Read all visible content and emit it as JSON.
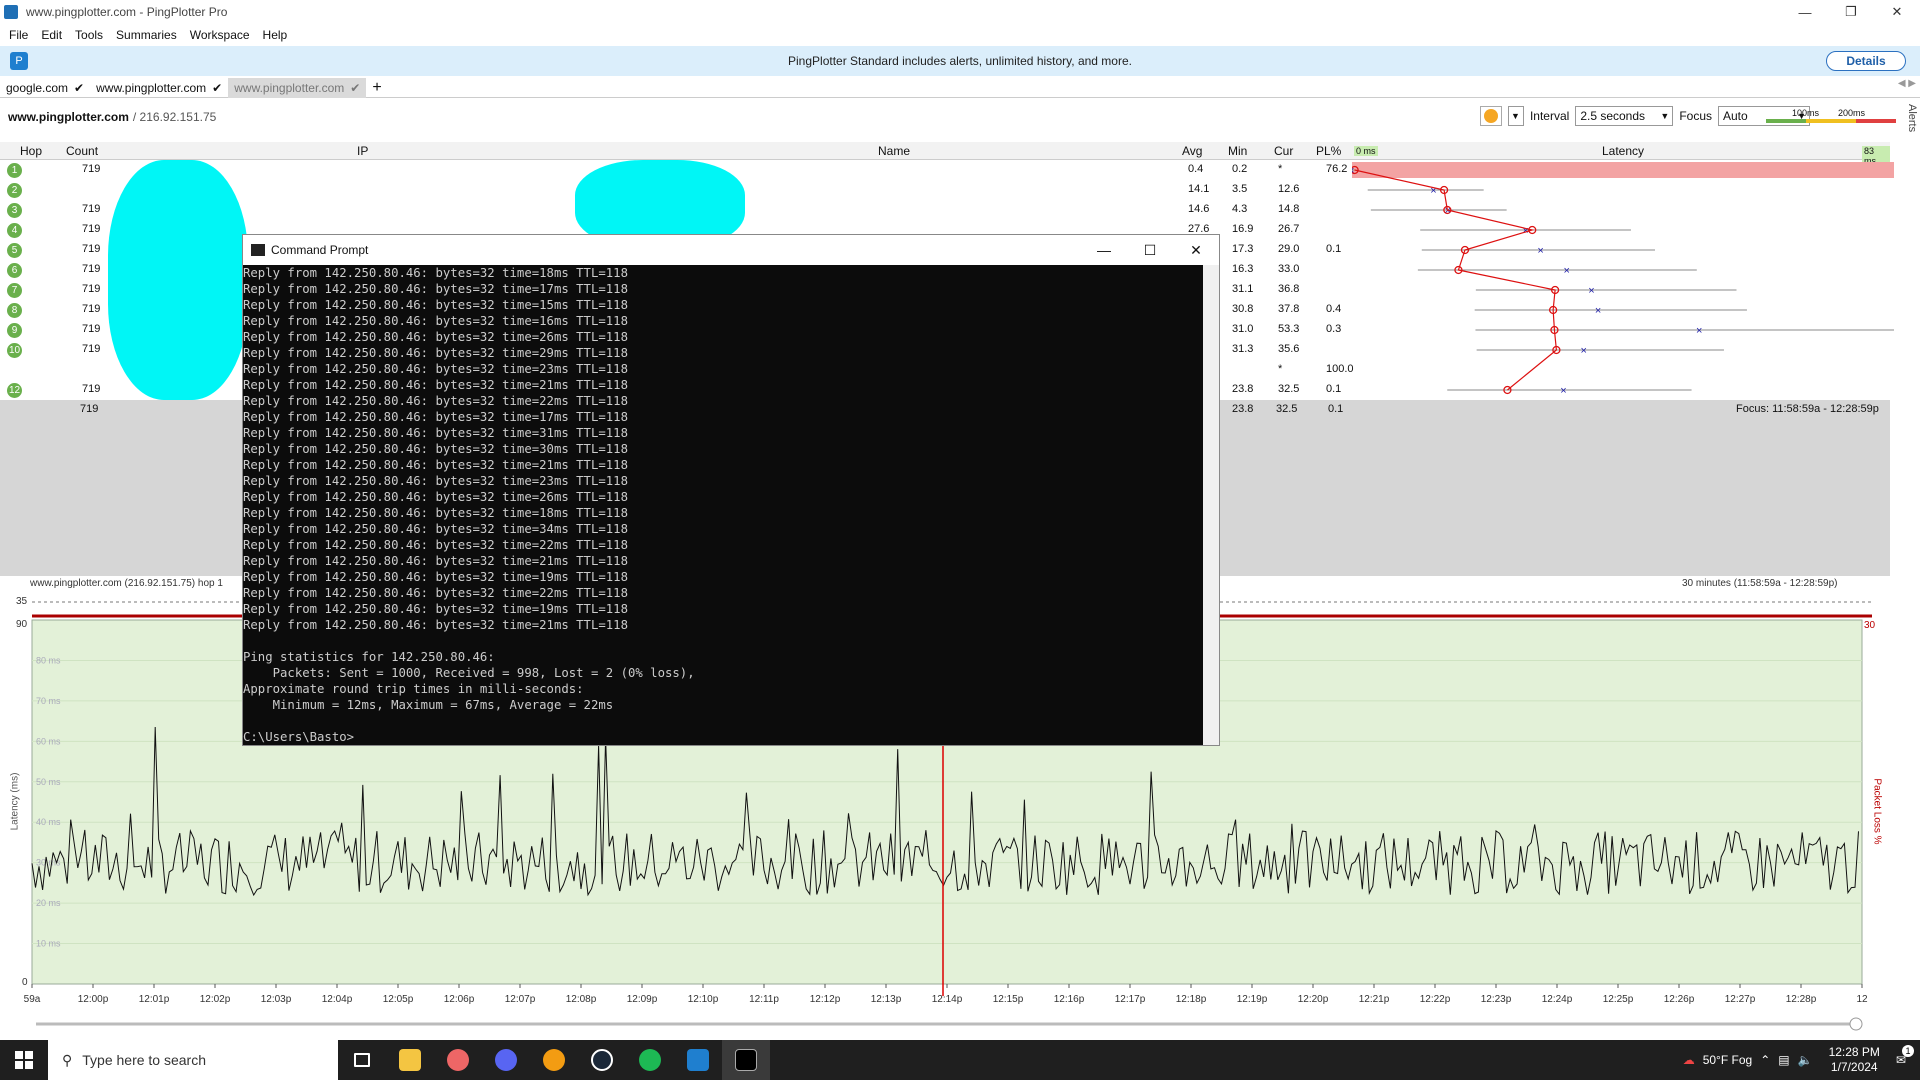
{
  "window": {
    "title": "www.pingplotter.com - PingPlotter Pro"
  },
  "menu": [
    "File",
    "Edit",
    "Tools",
    "Summaries",
    "Workspace",
    "Help"
  ],
  "banner": {
    "message": "PingPlotter Standard includes alerts, unlimited history, and more.",
    "details_label": "Details"
  },
  "tabs": [
    {
      "label": "google.com"
    },
    {
      "label": "www.pingplotter.com"
    },
    {
      "label": "www.pingplotter.com"
    }
  ],
  "target": {
    "host": "www.pingplotter.com",
    "ip": "/ 216.92.151.75"
  },
  "controls": {
    "interval_label": "Interval",
    "interval_value": "2.5 seconds",
    "focus_label": "Focus",
    "focus_value": "Auto",
    "scale_100": "100ms",
    "scale_200": "200ms",
    "alerts_label": "Alerts"
  },
  "grid": {
    "headers": {
      "hop": "Hop",
      "count": "Count",
      "ip": "IP",
      "name": "Name",
      "avg": "Avg",
      "min": "Min",
      "cur": "Cur",
      "pl": "PL%",
      "zero_ms": "0 ms",
      "latency": "Latency",
      "max_ms": "83 ms"
    },
    "rows": [
      {
        "hop": "1",
        "count": "719",
        "avg": "0.4",
        "min": "0.2",
        "cur": "*",
        "pl": "76.2"
      },
      {
        "hop": "2",
        "count": "",
        "avg": "14.1",
        "min": "3.5",
        "cur": "12.6",
        "pl": ""
      },
      {
        "hop": "3",
        "count": "719",
        "avg": "14.6",
        "min": "4.3",
        "cur": "14.8",
        "pl": ""
      },
      {
        "hop": "4",
        "count": "719",
        "avg": "27.6",
        "min": "16.9",
        "cur": "26.7",
        "pl": ""
      },
      {
        "hop": "5",
        "count": "719",
        "avg": "",
        "min": "17.3",
        "cur": "29.0",
        "pl": "0.1"
      },
      {
        "hop": "6",
        "count": "719",
        "avg": "",
        "min": "16.3",
        "cur": "33.0",
        "pl": ""
      },
      {
        "hop": "7",
        "count": "719",
        "avg": "",
        "min": "31.1",
        "cur": "36.8",
        "pl": ""
      },
      {
        "hop": "8",
        "count": "719",
        "avg": "",
        "min": "30.8",
        "cur": "37.8",
        "pl": "0.4"
      },
      {
        "hop": "9",
        "count": "719",
        "avg": "",
        "min": "31.0",
        "cur": "53.3",
        "pl": "0.3"
      },
      {
        "hop": "10",
        "count": "719",
        "avg": "",
        "min": "31.3",
        "cur": "35.6",
        "pl": ""
      },
      {
        "hop": "",
        "count": "",
        "avg": "",
        "min": "",
        "cur": "*",
        "pl": "100.0"
      },
      {
        "hop": "12",
        "count": "719",
        "avg": "",
        "min": "23.8",
        "cur": "32.5",
        "pl": "0.1"
      }
    ],
    "summary": {
      "count": "719",
      "min": "23.8",
      "cur": "32.5",
      "pl": "0.1",
      "focus": "Focus: 11:58:59a - 12:28:59p"
    }
  },
  "cmd": {
    "title": "Command Prompt",
    "lines": [
      "Reply from 142.250.80.46: bytes=32 time=18ms TTL=118",
      "Reply from 142.250.80.46: bytes=32 time=17ms TTL=118",
      "Reply from 142.250.80.46: bytes=32 time=15ms TTL=118",
      "Reply from 142.250.80.46: bytes=32 time=16ms TTL=118",
      "Reply from 142.250.80.46: bytes=32 time=26ms TTL=118",
      "Reply from 142.250.80.46: bytes=32 time=29ms TTL=118",
      "Reply from 142.250.80.46: bytes=32 time=23ms TTL=118",
      "Reply from 142.250.80.46: bytes=32 time=21ms TTL=118",
      "Reply from 142.250.80.46: bytes=32 time=22ms TTL=118",
      "Reply from 142.250.80.46: bytes=32 time=17ms TTL=118",
      "Reply from 142.250.80.46: bytes=32 time=31ms TTL=118",
      "Reply from 142.250.80.46: bytes=32 time=30ms TTL=118",
      "Reply from 142.250.80.46: bytes=32 time=21ms TTL=118",
      "Reply from 142.250.80.46: bytes=32 time=23ms TTL=118",
      "Reply from 142.250.80.46: bytes=32 time=26ms TTL=118",
      "Reply from 142.250.80.46: bytes=32 time=18ms TTL=118",
      "Reply from 142.250.80.46: bytes=32 time=34ms TTL=118",
      "Reply from 142.250.80.46: bytes=32 time=22ms TTL=118",
      "Reply from 142.250.80.46: bytes=32 time=21ms TTL=118",
      "Reply from 142.250.80.46: bytes=32 time=19ms TTL=118",
      "Reply from 142.250.80.46: bytes=32 time=22ms TTL=118",
      "Reply from 142.250.80.46: bytes=32 time=19ms TTL=118",
      "Reply from 142.250.80.46: bytes=32 time=21ms TTL=118",
      "",
      "Ping statistics for 142.250.80.46:",
      "    Packets: Sent = 1000, Received = 998, Lost = 2 (0% loss),",
      "Approximate round trip times in milli-seconds:",
      "    Minimum = 12ms, Maximum = 67ms, Average = 22ms",
      "",
      "C:\\Users\\Basto>"
    ]
  },
  "timeline": {
    "title": "www.pingplotter.com (216.92.151.75) hop 1",
    "range": "30 minutes (11:58:59a - 12:28:59p)",
    "pl_scale_left": "35",
    "lat_top": "90",
    "lat_bottom": "0",
    "pl_right": "30",
    "ylabel": "Latency (ms)",
    "y2label": "Packet Loss %",
    "gridlabels": [
      "80 ms",
      "70 ms",
      "60 ms",
      "50 ms",
      "40 ms",
      "30 ms",
      "20 ms",
      "10 ms"
    ],
    "ticks": [
      "59a",
      "12:00p",
      "12:01p",
      "12:02p",
      "12:03p",
      "12:04p",
      "12:05p",
      "12:06p",
      "12:07p",
      "12:08p",
      "12:09p",
      "12:10p",
      "12:11p",
      "12:12p",
      "12:13p",
      "12:14p",
      "12:15p",
      "12:16p",
      "12:17p",
      "12:18p",
      "12:19p",
      "12:20p",
      "12:21p",
      "12:22p",
      "12:23p",
      "12:24p",
      "12:25p",
      "12:26p",
      "12:27p",
      "12:28p",
      "12"
    ]
  },
  "taskbar": {
    "search_placeholder": "Type here to search",
    "weather": "50°F  Fog",
    "time": "12:28 PM",
    "date": "1/7/2024",
    "notif_count": "1"
  },
  "colors": {
    "accent": "#1f6fb5",
    "graph_bg": "#e3f1d8",
    "trace": "#d11"
  }
}
